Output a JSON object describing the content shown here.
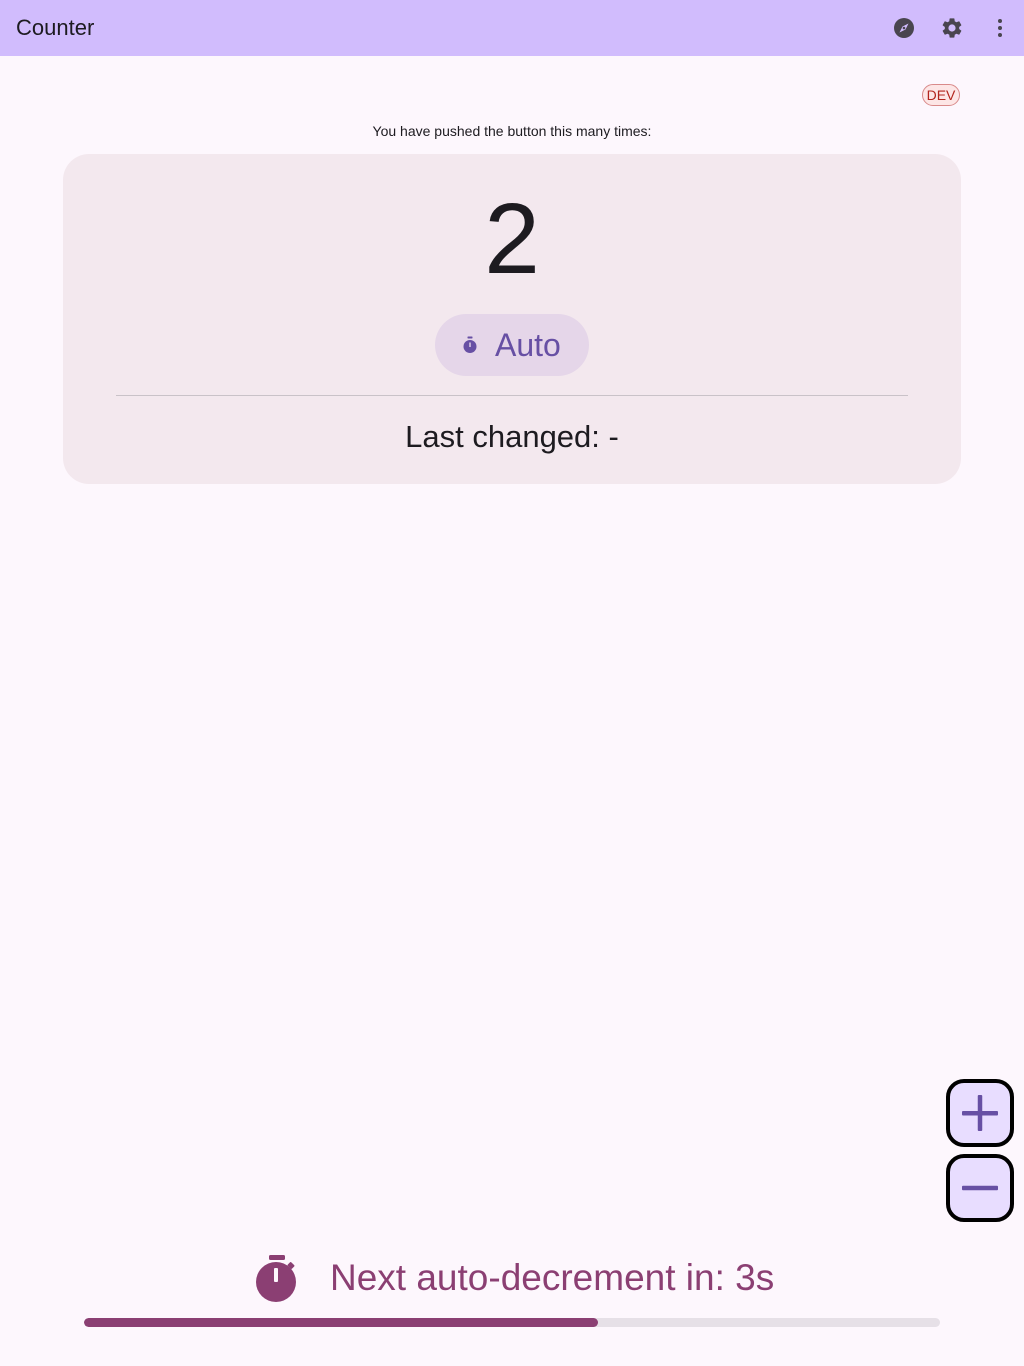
{
  "app_bar": {
    "title": "Counter",
    "icons": [
      "explore-icon",
      "settings-icon",
      "more-vert-icon"
    ]
  },
  "badge": {
    "label": "DEV"
  },
  "counter": {
    "caption": "You have pushed the button this many times:",
    "value": "2",
    "mode_chip": {
      "label": "Auto",
      "icon": "timer-icon"
    },
    "last_changed": "Last changed: -"
  },
  "fabs": {
    "increment_icon": "add-icon",
    "decrement_icon": "remove-icon"
  },
  "auto_decrement": {
    "label": "Next auto-decrement in: 3s",
    "icon": "timer-icon",
    "progress_fraction": 0.6
  },
  "colors": {
    "app_bar": "#d1bcfd",
    "accent": "#6750a4",
    "timer": "#8b3f73",
    "card": "#f3e8ee",
    "background": "#fdf7fd"
  }
}
